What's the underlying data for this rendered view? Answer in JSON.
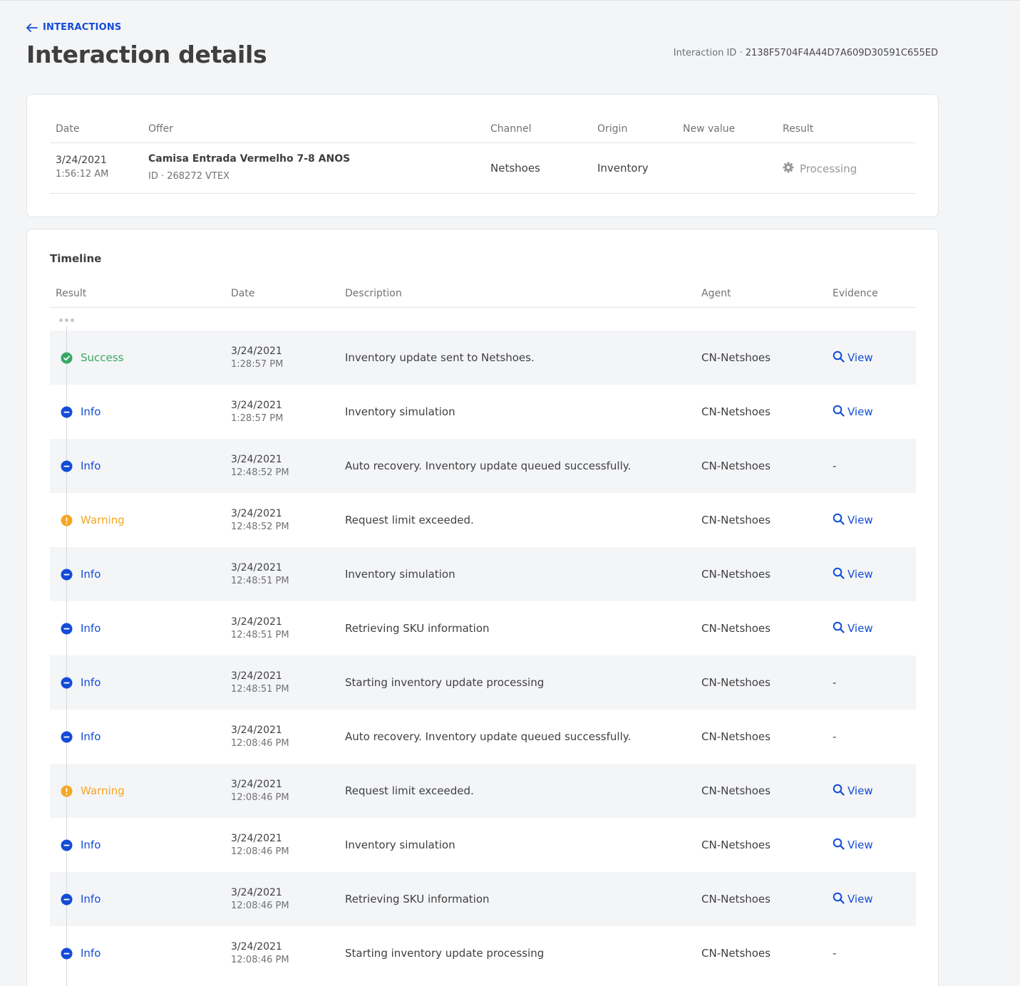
{
  "header": {
    "back_label": "INTERACTIONS",
    "title": "Interaction details",
    "interaction_id_label": "Interaction ID",
    "interaction_id_value": "2138F5704F4A44D7A609D30591C655ED"
  },
  "summary": {
    "columns": [
      "Date",
      "Offer",
      "Channel",
      "Origin",
      "New value",
      "Result"
    ],
    "row": {
      "date": "3/24/2021",
      "time": "1:56:12 AM",
      "offer_name": "Camisa Entrada Vermelho 7-8 ANOS",
      "offer_id": "ID · 268272 VTEX",
      "channel": "Netshoes",
      "origin": "Inventory",
      "new_value": "",
      "result": "Processing"
    }
  },
  "timeline": {
    "title": "Timeline",
    "columns": [
      "Result",
      "Date",
      "Description",
      "Agent",
      "Evidence"
    ],
    "colors": {
      "success": "#36a963",
      "info": "#134cd8",
      "warning": "#f5a623"
    },
    "rows": [
      {
        "status": "success",
        "result": "Success",
        "date": "3/24/2021",
        "time": "1:28:57 PM",
        "description": "Inventory update sent to Netshoes.",
        "agent": "CN-Netshoes",
        "evidence": "View"
      },
      {
        "status": "info",
        "result": "Info",
        "date": "3/24/2021",
        "time": "1:28:57 PM",
        "description": "Inventory simulation",
        "agent": "CN-Netshoes",
        "evidence": "View"
      },
      {
        "status": "info",
        "result": "Info",
        "date": "3/24/2021",
        "time": "12:48:52 PM",
        "description": "Auto recovery. Inventory update queued successfully.",
        "agent": "CN-Netshoes",
        "evidence": "-"
      },
      {
        "status": "warning",
        "result": "Warning",
        "date": "3/24/2021",
        "time": "12:48:52 PM",
        "description": "Request limit exceeded.",
        "agent": "CN-Netshoes",
        "evidence": "View"
      },
      {
        "status": "info",
        "result": "Info",
        "date": "3/24/2021",
        "time": "12:48:51 PM",
        "description": "Inventory simulation",
        "agent": "CN-Netshoes",
        "evidence": "View"
      },
      {
        "status": "info",
        "result": "Info",
        "date": "3/24/2021",
        "time": "12:48:51 PM",
        "description": "Retrieving SKU information",
        "agent": "CN-Netshoes",
        "evidence": "View"
      },
      {
        "status": "info",
        "result": "Info",
        "date": "3/24/2021",
        "time": "12:48:51 PM",
        "description": "Starting inventory update processing",
        "agent": "CN-Netshoes",
        "evidence": "-"
      },
      {
        "status": "info",
        "result": "Info",
        "date": "3/24/2021",
        "time": "12:08:46 PM",
        "description": "Auto recovery. Inventory update queued successfully.",
        "agent": "CN-Netshoes",
        "evidence": "-"
      },
      {
        "status": "warning",
        "result": "Warning",
        "date": "3/24/2021",
        "time": "12:08:46 PM",
        "description": "Request limit exceeded.",
        "agent": "CN-Netshoes",
        "evidence": "View"
      },
      {
        "status": "info",
        "result": "Info",
        "date": "3/24/2021",
        "time": "12:08:46 PM",
        "description": "Inventory simulation",
        "agent": "CN-Netshoes",
        "evidence": "View"
      },
      {
        "status": "info",
        "result": "Info",
        "date": "3/24/2021",
        "time": "12:08:46 PM",
        "description": "Retrieving SKU information",
        "agent": "CN-Netshoes",
        "evidence": "View"
      },
      {
        "status": "info",
        "result": "Info",
        "date": "3/24/2021",
        "time": "12:08:46 PM",
        "description": "Starting inventory update processing",
        "agent": "CN-Netshoes",
        "evidence": "-"
      }
    ]
  }
}
